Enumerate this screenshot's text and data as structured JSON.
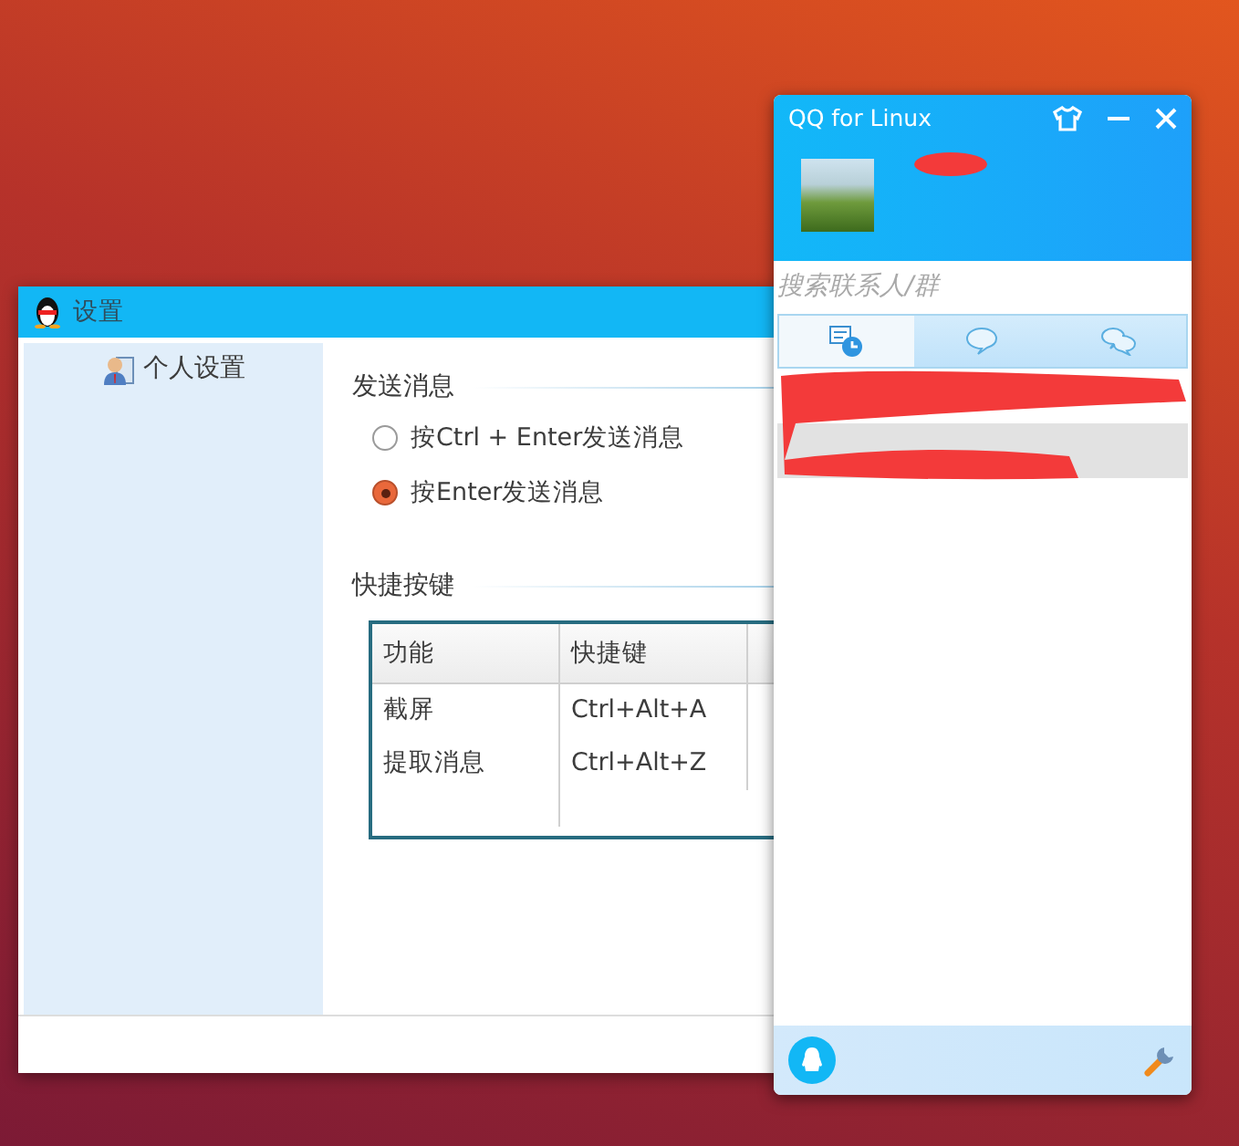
{
  "settings_window": {
    "title": "设置",
    "sidebar": {
      "items": [
        {
          "label": "个人设置"
        }
      ]
    },
    "sections": [
      {
        "kind": "radio-group",
        "title": "发送消息",
        "options": [
          {
            "label": "按Ctrl + Enter发送消息",
            "selected": false
          },
          {
            "label": "按Enter发送消息",
            "selected": true
          }
        ]
      },
      {
        "kind": "table",
        "title": "快捷按键",
        "table": {
          "columns": [
            "功能",
            "快捷键"
          ],
          "rows": [
            [
              "截屏",
              "Ctrl+Alt+A"
            ],
            [
              "提取消息",
              "Ctrl+Alt+Z"
            ]
          ]
        }
      }
    ]
  },
  "qq_window": {
    "title": "QQ for Linux",
    "search": {
      "placeholder": "搜索联系人/群"
    },
    "tabs": [
      {
        "kind": "recent",
        "selected": true
      },
      {
        "kind": "chat",
        "selected": false
      },
      {
        "kind": "group",
        "selected": false
      }
    ]
  }
}
